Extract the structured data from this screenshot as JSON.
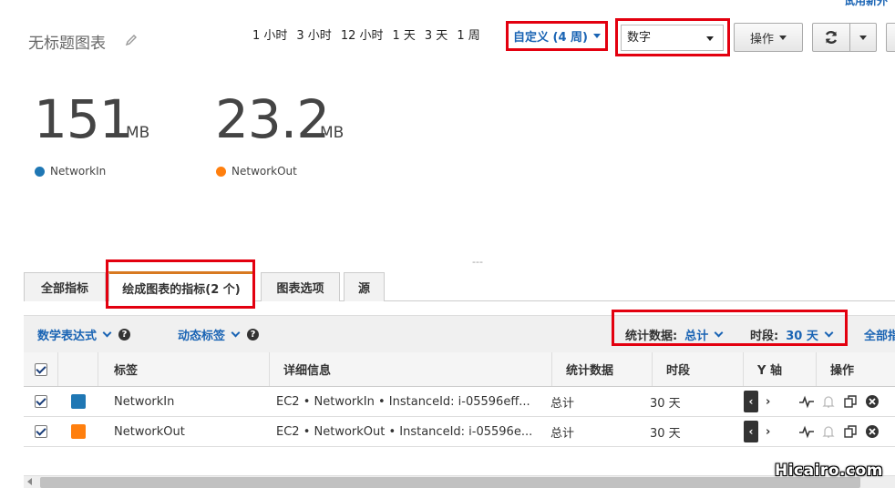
{
  "header": {
    "top_link": "试用新外",
    "title": "无标题图表",
    "time_ranges": [
      "1 小时",
      "3 小时",
      "12 小时",
      "1 天",
      "3 天",
      "1 周"
    ],
    "custom_range": "自定义 (4 周)",
    "view_select": "数字",
    "actions_button": "操作"
  },
  "metrics": [
    {
      "value": "151",
      "unit": "MB",
      "label": "NetworkIn",
      "color": "#1f77b4"
    },
    {
      "value": "23.2",
      "unit": "MB",
      "label": "NetworkOut",
      "color": "#ff7f0e"
    }
  ],
  "divider": "---",
  "tabs": [
    {
      "label": "全部指标"
    },
    {
      "label": "绘成图表的指标(2 个)"
    },
    {
      "label": "图表选项"
    },
    {
      "label": "源"
    }
  ],
  "toolbar": {
    "math_expression": "数学表达式",
    "dynamic_labels": "动态标签",
    "statistic_label": "统计数据:",
    "statistic_value": "总计",
    "period_label": "时段:",
    "period_value": "30 天",
    "all_link": "全部指"
  },
  "table": {
    "columns": [
      "标签",
      "详细信息",
      "统计数据",
      "时段",
      "Y 轴",
      "操作"
    ],
    "rows": [
      {
        "label": "NetworkIn",
        "color": "#1f77b4",
        "details": "EC2 • NetworkIn • InstanceId: i-05596eff...",
        "statistic": "总计",
        "period": "30 天"
      },
      {
        "label": "NetworkOut",
        "color": "#ff7f0e",
        "details": "EC2 • NetworkOut • InstanceId: i-05596e...",
        "statistic": "总计",
        "period": "30 天"
      }
    ]
  },
  "watermark": "Hicairo.com",
  "colors": {
    "accent": "#1a64b4",
    "highlight_box": "#e3000f",
    "active_tab": "#d87a21"
  }
}
